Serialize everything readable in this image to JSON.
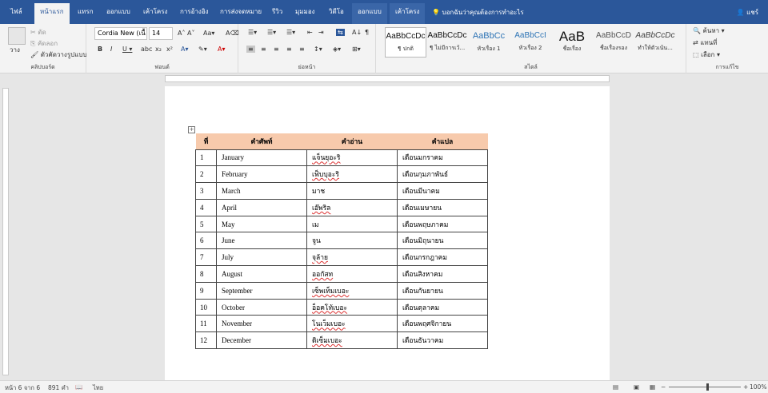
{
  "tabs": [
    "ไฟล์",
    "หน้าแรก",
    "แทรก",
    "ออกแบบ",
    "เค้าโครง",
    "การอ้างอิง",
    "การส่งจดหมาย",
    "รีวิว",
    "มุมมอง",
    "วิดีโอ",
    "ออกแบบ",
    "เค้าโครง"
  ],
  "tell_me": "บอกฉันว่าคุณต้องการทำอะไร",
  "user": "แชร์",
  "clipboard": {
    "paste": "วาง",
    "cut": "ตัด",
    "copy": "คัดลอก",
    "format_painter": "ตัวคัดวางรูปแบบ",
    "label": "คลิปบอร์ด"
  },
  "font": {
    "name": "Cordia New (เนื้",
    "size": "14",
    "label": "ฟอนต์"
  },
  "paragraph": {
    "label": "ย่อหน้า"
  },
  "styles": {
    "label": "สไตล์",
    "items": [
      {
        "sample": "AaBbCcDc",
        "name": "¶ ปกติ"
      },
      {
        "sample": "AaBbCcDc",
        "name": "¶ ไม่มีการเว้..."
      },
      {
        "sample": "AaBbCc",
        "name": "หัวเรื่อง 1"
      },
      {
        "sample": "AaBbCcI",
        "name": "หัวเรื่อง 2"
      },
      {
        "sample": "AaB",
        "name": "ชื่อเรื่อง"
      },
      {
        "sample": "AaBbCcD",
        "name": "ชื่อเรื่องรอง"
      },
      {
        "sample": "AaBbCcDc",
        "name": "ทำให้ตัวเน้น..."
      }
    ]
  },
  "editing": {
    "find": "ค้นหา",
    "replace": "แทนที่",
    "select": "เลือก",
    "label": "การแก้ไข"
  },
  "table": {
    "headers": [
      "ที่",
      "คำศัพท์",
      "คำอ่าน",
      "คำแปล"
    ],
    "rows": [
      [
        "1",
        "January",
        "แจ็นยุอะริ",
        "เดือนมกราคม"
      ],
      [
        "2",
        "February",
        "เฟ็บบุอะริ",
        "เดือนกุมภาพันธ์"
      ],
      [
        "3",
        "March",
        "มาช",
        "เดือนมีนาคม"
      ],
      [
        "4",
        "April",
        "เอ๊พริล",
        "เดือนเมษายน"
      ],
      [
        "5",
        "May",
        "เม",
        "เดือนพฤษภาคม"
      ],
      [
        "6",
        "June",
        "จูน",
        "เดือนมิถุนายน"
      ],
      [
        "7",
        "July",
        "จุล้าย",
        "เดือนกรกฎาคม"
      ],
      [
        "8",
        "August",
        "ออกัสท",
        "เดือนสิงหาคม"
      ],
      [
        "9",
        "September",
        "เซ็พเท็มเบอะ",
        "เดือนกันยายน"
      ],
      [
        "10",
        "October",
        "อ็อคโท้เบอะ",
        "เดือนตุลาคม"
      ],
      [
        "11",
        "November",
        "โนเว็มเบอะ",
        "เดือนพฤศจิกายน"
      ],
      [
        "12",
        "December",
        "ดิเซ็มเบอะ",
        "เดือนธันวาคม"
      ]
    ],
    "wavy_reading_rows": [
      1,
      2,
      4,
      7,
      8,
      9,
      10,
      11,
      12
    ]
  },
  "status": {
    "page": "หน้า 6 จาก 6",
    "words": "891 คำ",
    "lang": "ไทย",
    "zoom": "100%"
  },
  "colors": {
    "brand": "#2b579a",
    "header_fill": "#f7caac"
  }
}
